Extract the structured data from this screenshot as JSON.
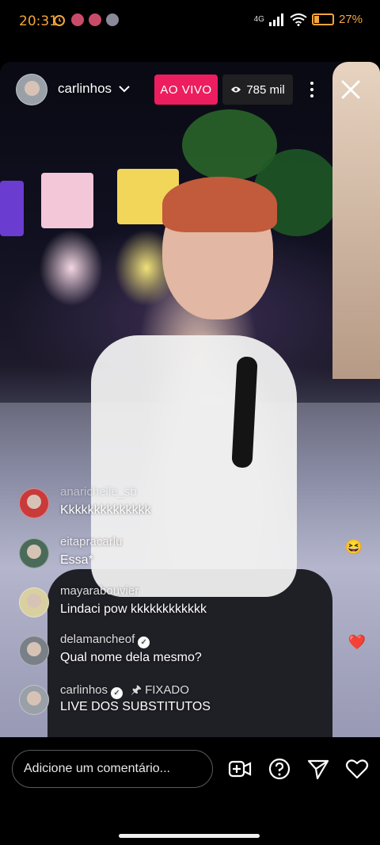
{
  "status_bar": {
    "time": "20:31",
    "network": "4G",
    "battery": "27%"
  },
  "live": {
    "host_name": "carlinhos",
    "live_label": "AO VIVO",
    "viewers": "785 mil"
  },
  "comments": [
    {
      "user": "anarichelle_sb",
      "text": "Kkkkkkkkkkkkkk",
      "verified": false,
      "reaction": ""
    },
    {
      "user": "eitapracarlu",
      "text": "Essa*",
      "verified": false,
      "reaction": "😆"
    },
    {
      "user": "mayarabouvier",
      "text": "Lindaci pow kkkkkkkkkkkk",
      "verified": false,
      "reaction": ""
    },
    {
      "user": "delamancheof",
      "text": "Qual nome dela mesmo?",
      "verified": true,
      "reaction": "❤️"
    },
    {
      "user": "carlinhos",
      "text": "LIVE DOS SUBSTITUTOS",
      "verified": true,
      "pinned_label": "FIXADO"
    }
  ],
  "composer": {
    "placeholder": "Adicione um comentário..."
  },
  "icons": {
    "eye": "eye-icon",
    "more": "more-vertical-icon",
    "close": "close-icon",
    "add_guest": "video-add-icon",
    "question": "question-icon",
    "send": "send-icon",
    "like": "heart-icon"
  },
  "colors": {
    "live_badge": "#ec1e5f",
    "status_text": "#f4a53c"
  }
}
